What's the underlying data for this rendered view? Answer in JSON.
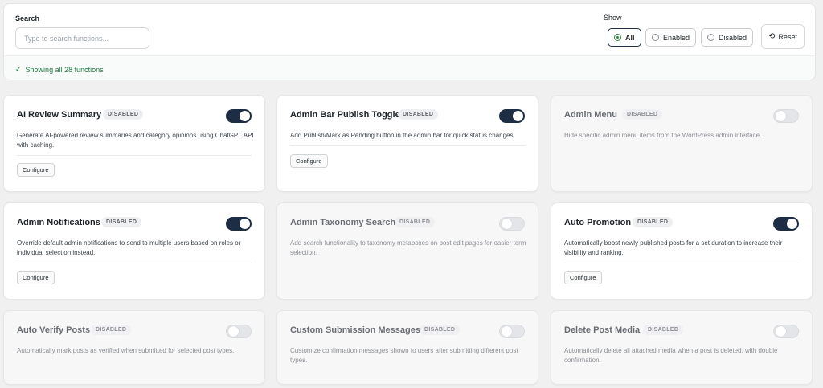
{
  "search": {
    "label": "Search",
    "placeholder": "Type to search functions...",
    "value": ""
  },
  "filter": {
    "label": "Show",
    "options": [
      {
        "label": "All",
        "selected": true
      },
      {
        "label": "Enabled",
        "selected": false
      },
      {
        "label": "Disabled",
        "selected": false
      }
    ],
    "reset_label": "Reset"
  },
  "status": {
    "text": "Showing all 28 functions"
  },
  "colors": {
    "accent": "#1d2d44",
    "success": "#1a7a3a"
  },
  "cards": [
    {
      "title": "AI Review Summary",
      "badge": "DISABLED",
      "enabled": true,
      "description": "Generate AI-powered review summaries and category opinions using ChatGPT API with caching.",
      "configure_label": "Configure"
    },
    {
      "title": "Admin Bar Publish Toggle",
      "badge": "DISABLED",
      "enabled": true,
      "description": "Add Publish/Mark as Pending button in the admin bar for quick status changes.",
      "configure_label": "Configure"
    },
    {
      "title": "Admin Menu",
      "badge": "DISABLED",
      "enabled": false,
      "description": "Hide specific admin menu items from the WordPress admin interface."
    },
    {
      "title": "Admin Notifications",
      "badge": "DISABLED",
      "enabled": true,
      "description": "Override default admin notifications to send to multiple users based on roles or individual selection instead.",
      "configure_label": "Configure"
    },
    {
      "title": "Admin Taxonomy Search",
      "badge": "DISABLED",
      "enabled": false,
      "description": "Add search functionality to taxonomy metaboxes on post edit pages for easier term selection."
    },
    {
      "title": "Auto Promotion",
      "badge": "DISABLED",
      "enabled": true,
      "description": "Automatically boost newly published posts for a set duration to increase their visibility and ranking.",
      "configure_label": "Configure"
    },
    {
      "title": "Auto Verify Posts",
      "badge": "DISABLED",
      "enabled": false,
      "description": "Automatically mark posts as verified when submitted for selected post types."
    },
    {
      "title": "Custom Submission Messages",
      "badge": "DISABLED",
      "enabled": false,
      "description": "Customize confirmation messages shown to users after submitting different post types."
    },
    {
      "title": "Delete Post Media",
      "badge": "DISABLED",
      "enabled": false,
      "description": "Automatically delete all attached media when a post is deleted, with double confirmation."
    }
  ]
}
